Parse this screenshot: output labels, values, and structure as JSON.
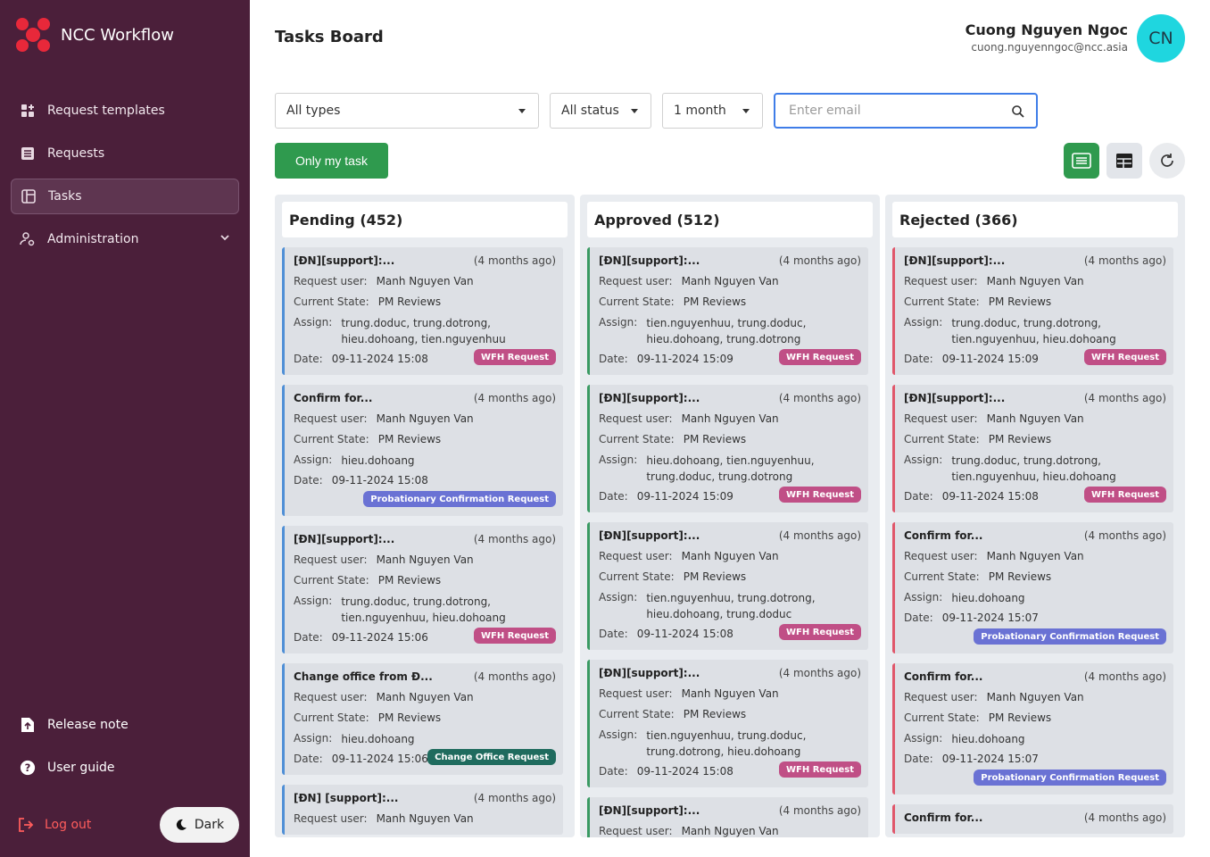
{
  "app": {
    "name": "NCC Workflow"
  },
  "sidebar": {
    "items": [
      {
        "label": "Request templates",
        "icon": "request-templates-icon"
      },
      {
        "label": "Requests",
        "icon": "requests-icon"
      },
      {
        "label": "Tasks",
        "icon": "tasks-icon",
        "active": true
      },
      {
        "label": "Administration",
        "icon": "administration-icon"
      }
    ],
    "bottom": [
      {
        "label": "Release note",
        "icon": "release-note-icon"
      },
      {
        "label": "User guide",
        "icon": "help-icon"
      }
    ],
    "logout": "Log out",
    "dark": "Dark"
  },
  "header": {
    "title": "Tasks Board",
    "user_name": "Cuong Nguyen Ngoc",
    "user_email": "cuong.nguyenngoc@ncc.asia",
    "avatar": "CN"
  },
  "filters": {
    "type": "All types",
    "status": "All status",
    "period": "1 month",
    "email_placeholder": "Enter email",
    "only_my_task": "Only my task"
  },
  "colors": {
    "sidebar": "#4b1f3a",
    "accent_green": "#2f9a4e",
    "pending": "#4f8fd6",
    "approved": "#3a9a63",
    "rejected": "#e0566a"
  },
  "columns": {
    "pending": {
      "title": "Pending (452)",
      "cards": [
        {
          "title": "[ĐN][support]:...",
          "ago": "(4 months ago)",
          "user": "Manh Nguyen Van",
          "state": "PM Reviews",
          "assign": "trung.doduc, trung.dotrong, hieu.dohoang, tien.nguyenhuu",
          "date": "09-11-2024 15:08",
          "badge": "WFH Request"
        },
        {
          "title": "Confirm for...",
          "ago": "(4 months ago)",
          "user": "Manh Nguyen Van",
          "state": "PM Reviews",
          "assign": "hieu.dohoang",
          "date": "09-11-2024 15:08",
          "badge": "Probationary Confirmation Request"
        },
        {
          "title": "[ĐN][support]:...",
          "ago": "(4 months ago)",
          "user": "Manh Nguyen Van",
          "state": "PM Reviews",
          "assign": "trung.doduc, trung.dotrong, tien.nguyenhuu, hieu.dohoang",
          "date": "09-11-2024 15:06",
          "badge": "WFH Request"
        },
        {
          "title": "Change office from Đ...",
          "ago": "(4 months ago)",
          "user": "Manh Nguyen Van",
          "state": "PM Reviews",
          "assign": "hieu.dohoang",
          "date": "09-11-2024 15:06",
          "badge": "Change Office Request"
        },
        {
          "title": "[ĐN] [support]:...",
          "ago": "(4 months ago)",
          "user": "Manh Nguyen Van"
        }
      ]
    },
    "approved": {
      "title": "Approved (512)",
      "cards": [
        {
          "title": "[ĐN][support]:...",
          "ago": "(4 months ago)",
          "user": "Manh Nguyen Van",
          "state": "PM Reviews",
          "assign": "tien.nguyenhuu, trung.doduc, hieu.dohoang, trung.dotrong",
          "date": "09-11-2024 15:09",
          "badge": "WFH Request"
        },
        {
          "title": "[ĐN][support]:...",
          "ago": "(4 months ago)",
          "user": "Manh Nguyen Van",
          "state": "PM Reviews",
          "assign": "hieu.dohoang, tien.nguyenhuu, trung.doduc, trung.dotrong",
          "date": "09-11-2024 15:09",
          "badge": "WFH Request"
        },
        {
          "title": "[ĐN][support]:...",
          "ago": "(4 months ago)",
          "user": "Manh Nguyen Van",
          "state": "PM Reviews",
          "assign": "tien.nguyenhuu, trung.dotrong, hieu.dohoang, trung.doduc",
          "date": "09-11-2024 15:08",
          "badge": "WFH Request"
        },
        {
          "title": "[ĐN][support]:...",
          "ago": "(4 months ago)",
          "user": "Manh Nguyen Van",
          "state": "PM Reviews",
          "assign": "tien.nguyenhuu, trung.doduc, trung.dotrong, hieu.dohoang",
          "date": "09-11-2024 15:08",
          "badge": "WFH Request"
        },
        {
          "title": "[ĐN][support]:...",
          "ago": "(4 months ago)",
          "user": "Manh Nguyen Van"
        }
      ]
    },
    "rejected": {
      "title": "Rejected (366)",
      "cards": [
        {
          "title": "[ĐN][support]:...",
          "ago": "(4 months ago)",
          "user": "Manh Nguyen Van",
          "state": "PM Reviews",
          "assign": "trung.doduc, trung.dotrong, tien.nguyenhuu, hieu.dohoang",
          "date": "09-11-2024 15:09",
          "badge": "WFH Request"
        },
        {
          "title": "[ĐN][support]:...",
          "ago": "(4 months ago)",
          "user": "Manh Nguyen Van",
          "state": "PM Reviews",
          "assign": "trung.doduc, trung.dotrong, tien.nguyenhuu, hieu.dohoang",
          "date": "09-11-2024 15:08",
          "badge": "WFH Request"
        },
        {
          "title": "Confirm for...",
          "ago": "(4 months ago)",
          "user": "Manh Nguyen Van",
          "state": "PM Reviews",
          "assign": "hieu.dohoang",
          "date": "09-11-2024 15:07",
          "badge": "Probationary Confirmation Request"
        },
        {
          "title": "Confirm for...",
          "ago": "(4 months ago)",
          "user": "Manh Nguyen Van",
          "state": "PM Reviews",
          "assign": "hieu.dohoang",
          "date": "09-11-2024 15:07",
          "badge": "Probationary Confirmation Request"
        },
        {
          "title": "Confirm for...",
          "ago": "(4 months ago)"
        }
      ]
    }
  },
  "labels": {
    "request_user": "Request user:",
    "current_state": "Current State:",
    "assign": "Assign:",
    "date": "Date:"
  }
}
